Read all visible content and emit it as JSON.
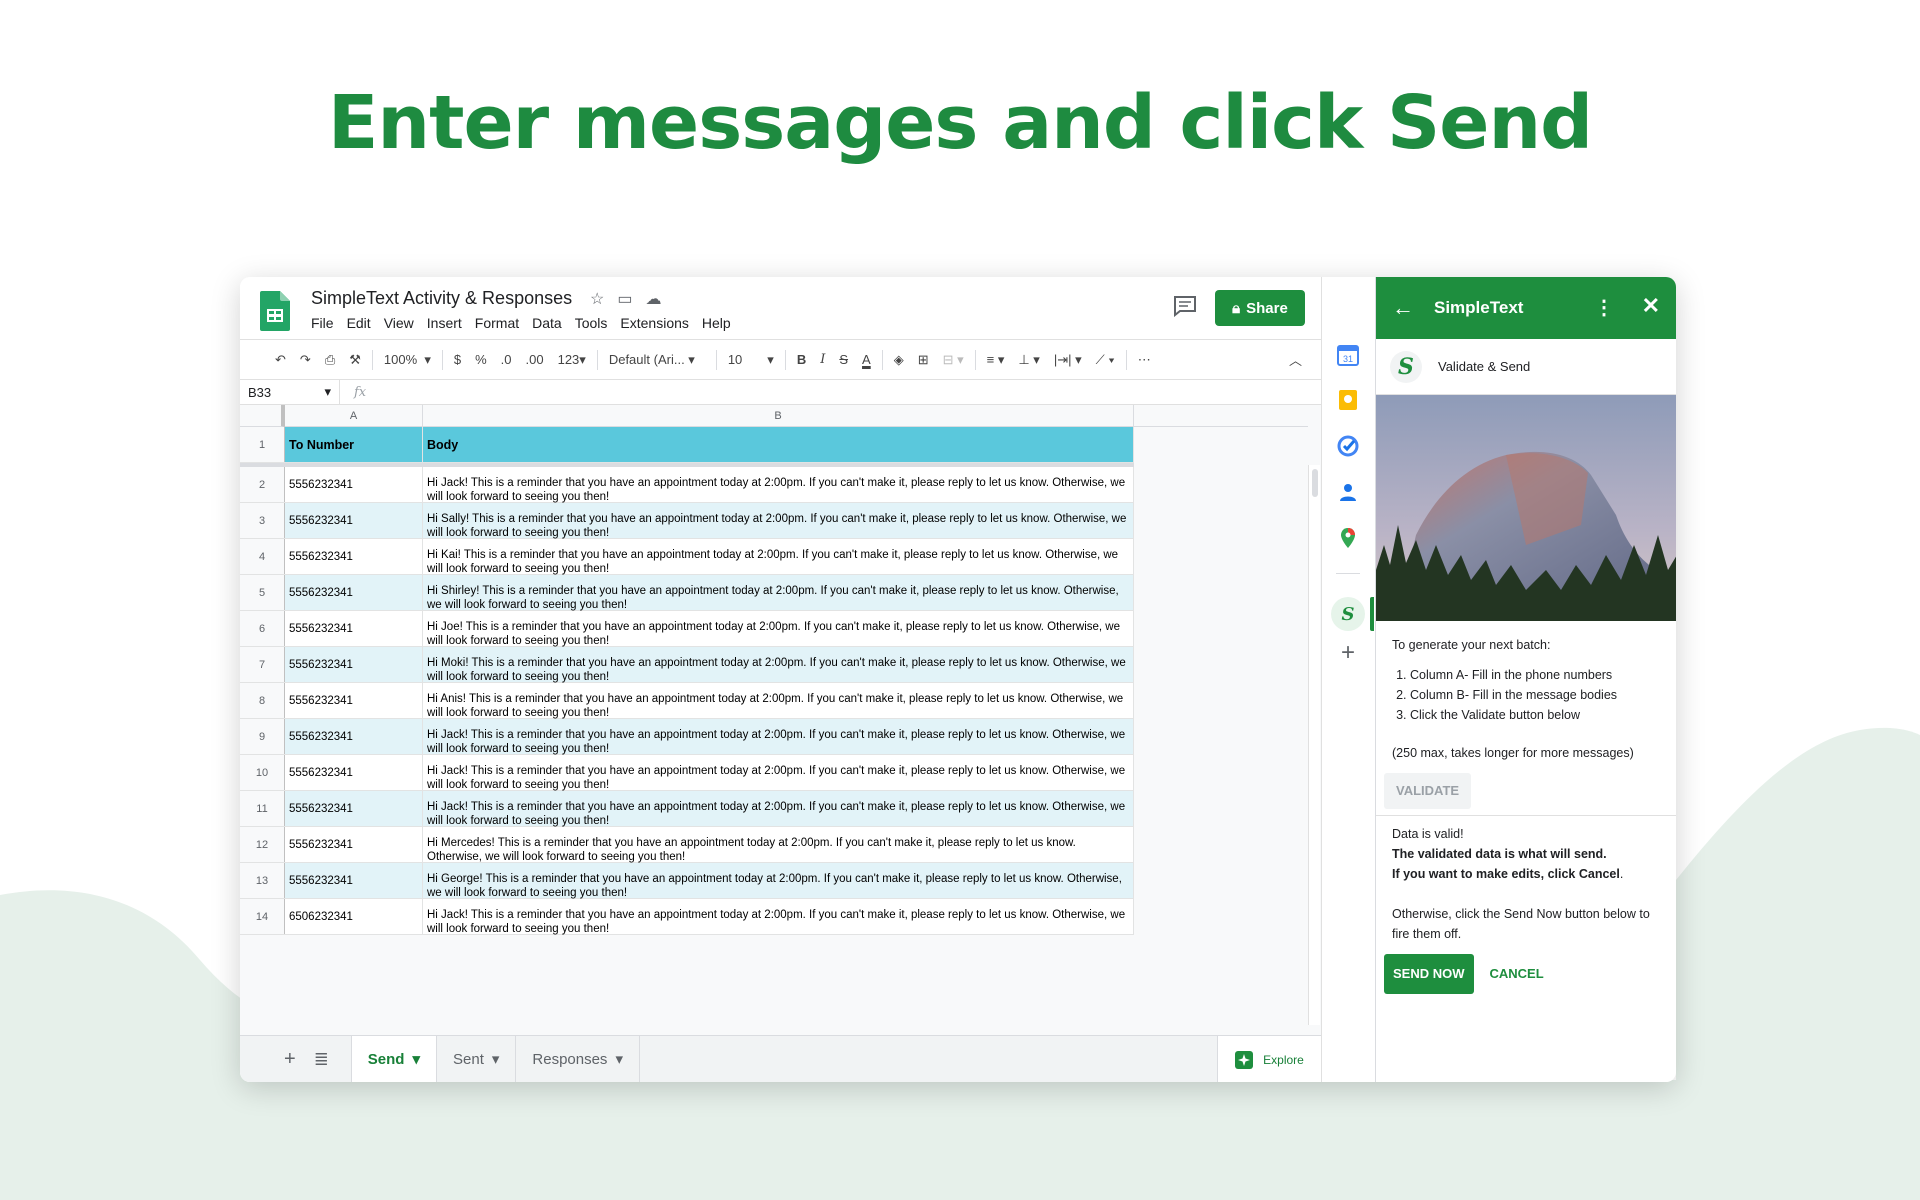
{
  "headline": "Enter messages and click Send",
  "colors": {
    "brand_green": "#1e8e3e",
    "header_cyan": "#5ac8dc",
    "alt_row": "#e2f3f8"
  },
  "sheet": {
    "title": "SimpleText Activity & Responses",
    "menu": [
      "File",
      "Edit",
      "View",
      "Insert",
      "Format",
      "Data",
      "Tools",
      "Extensions",
      "Help"
    ],
    "share_label": "Share",
    "toolbar": {
      "zoom": "100%",
      "currency": "$",
      "percent": "%",
      "dec_dec": ".0",
      "dec_inc": ".00",
      "format": "123",
      "font": "Default (Ari...",
      "font_size": "10",
      "bold": "B",
      "italic": "I",
      "strike": "S",
      "textcolor": "A"
    },
    "namebox": "B33",
    "fx": "fx",
    "columns": [
      "A",
      "B"
    ],
    "header_row": {
      "num": "1",
      "a": "To Number",
      "b": "Body"
    },
    "rows": [
      {
        "num": "2",
        "a": "5556232341",
        "b": "Hi Jack! This is a reminder that you have an appointment today at 2:00pm. If you can't make it, please reply to let us know. Otherwise, we will look forward to seeing you then!"
      },
      {
        "num": "3",
        "a": "5556232341",
        "b": "Hi Sally! This is a reminder that you have an appointment today at 2:00pm. If you can't make it, please reply to let us know. Otherwise, we will look forward to seeing you then!"
      },
      {
        "num": "4",
        "a": "5556232341",
        "b": "Hi Kai! This is a reminder that you have an appointment today at 2:00pm. If you can't make it, please reply to let us know. Otherwise, we will look forward to seeing you then!"
      },
      {
        "num": "5",
        "a": "5556232341",
        "b": "Hi Shirley! This is a reminder that you have an appointment today at 2:00pm. If you can't make it, please reply to let us know. Otherwise, we will look forward to seeing you then!"
      },
      {
        "num": "6",
        "a": "5556232341",
        "b": "Hi Joe! This is a reminder that you have an appointment today at 2:00pm. If you can't make it, please reply to let us know. Otherwise, we will look forward to seeing you then!"
      },
      {
        "num": "7",
        "a": "5556232341",
        "b": "Hi Moki! This is a reminder that you have an appointment today at 2:00pm. If you can't make it, please reply to let us know. Otherwise, we will look forward to seeing you then!"
      },
      {
        "num": "8",
        "a": "5556232341",
        "b": "Hi Anis! This is a reminder that you have an appointment today at 2:00pm. If you can't make it, please reply to let us know. Otherwise, we will look forward to seeing you then!"
      },
      {
        "num": "9",
        "a": "5556232341",
        "b": "Hi Jack! This is a reminder that you have an appointment today at 2:00pm. If you can't make it, please reply to let us know. Otherwise, we will look forward to seeing you then!"
      },
      {
        "num": "10",
        "a": "5556232341",
        "b": "Hi Jack! This is a reminder that you have an appointment today at 2:00pm. If you can't make it, please reply to let us know. Otherwise, we will look forward to seeing you then!"
      },
      {
        "num": "11",
        "a": "5556232341",
        "b": "Hi Jack! This is a reminder that you have an appointment today at 2:00pm. If you can't make it, please reply to let us know. Otherwise, we will look forward to seeing you then!"
      },
      {
        "num": "12",
        "a": "5556232341",
        "b": "Hi Mercedes! This is a reminder that you have an appointment today at 2:00pm. If you can't make it, please reply to let us know. Otherwise, we will look forward to seeing you then!"
      },
      {
        "num": "13",
        "a": "5556232341",
        "b": "Hi George! This is a reminder that you have an appointment today at 2:00pm. If you can't make it, please reply to let us know. Otherwise, we will look forward to seeing you then!"
      },
      {
        "num": "14",
        "a": "6506232341",
        "b": "Hi Jack! This is a reminder that you have an appointment today at 2:00pm. If you can't make it, please reply to let us know. Otherwise, we will look forward to seeing you then!"
      }
    ],
    "tabs": [
      {
        "label": "Send",
        "active": true
      },
      {
        "label": "Sent",
        "active": false
      },
      {
        "label": "Responses",
        "active": false
      }
    ],
    "explore_label": "Explore"
  },
  "panel": {
    "title": "SimpleText",
    "logo_letter": "S",
    "subtitle": "Validate & Send",
    "intro": "To generate your next batch:",
    "steps": [
      "Column A- Fill in the phone numbers",
      "Column B- Fill in the message bodies",
      "Click the Validate button below"
    ],
    "note": "(250 max, takes longer for more messages)",
    "validate_label": "VALIDATE",
    "valid_msg": "Data is valid!",
    "bold_line1": "The validated data is what will send.",
    "bold_line2_prefix": "If you want to make edits, click Cancel",
    "bold_line2_suffix": ".",
    "otherwise": "Otherwise, click the Send Now button below to fire them off.",
    "send_label": "SEND NOW",
    "cancel_label": "CANCEL"
  }
}
